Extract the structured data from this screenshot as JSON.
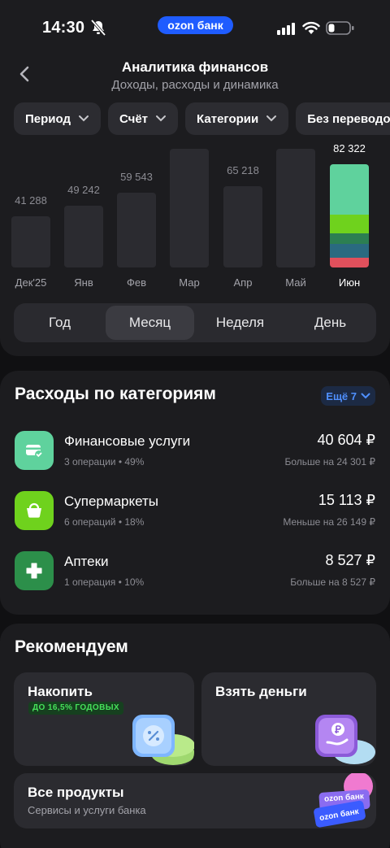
{
  "status_bar": {
    "time": "14:30",
    "bank_label": "ozon банк",
    "icons": [
      "bell-muted-icon",
      "signal-icon",
      "wifi-icon",
      "battery-icon"
    ]
  },
  "header": {
    "title": "Аналитика финансов",
    "subtitle": "Доходы, расходы и динамика"
  },
  "filters": [
    {
      "label": "Период"
    },
    {
      "label": "Счёт"
    },
    {
      "label": "Категории"
    },
    {
      "label": "Без переводов"
    }
  ],
  "chart_data": {
    "type": "bar",
    "categories": [
      "Дек'25",
      "Янв",
      "Фев",
      "Мар",
      "Апр",
      "Май",
      "Июн"
    ],
    "values": [
      41288,
      49242,
      59543,
      null,
      65218,
      null,
      82322
    ],
    "value_labels": [
      "41 288",
      "49 242",
      "59 543",
      "",
      "65 218",
      "",
      "82 322"
    ],
    "active_index": 6,
    "active_segments": [
      {
        "color": "#5fd29d",
        "share": 0.49
      },
      {
        "color": "#6fd21d",
        "share": 0.18
      },
      {
        "color": "#2c7f52",
        "share": 0.1
      },
      {
        "color": "#2a6a80",
        "share": 0.13
      },
      {
        "color": "#e0505c",
        "share": 0.1
      }
    ]
  },
  "period_tabs": [
    {
      "label": "Год",
      "selected": false
    },
    {
      "label": "Месяц",
      "selected": true
    },
    {
      "label": "Неделя",
      "selected": false
    },
    {
      "label": "День",
      "selected": false
    }
  ],
  "categories_section": {
    "title": "Расходы по категориям",
    "more_label": "Ещё 7",
    "items": [
      {
        "name": "Финансовые услуги",
        "meta": "3 операции • 49%",
        "amount": "40 604 ₽",
        "diff": "Больше на 24 301 ₽",
        "color": "#5fd29d",
        "icon": "card-check-icon"
      },
      {
        "name": "Супермаркеты",
        "meta": "6 операций • 18%",
        "amount": "15 113 ₽",
        "diff": "Меньше на 26 149 ₽",
        "color": "#6fd21d",
        "icon": "shopping-basket-icon"
      },
      {
        "name": "Аптеки",
        "meta": "1 операция • 10%",
        "amount": "8 527 ₽",
        "diff": "Больше на 8 527 ₽",
        "color": "#2c8f4a",
        "icon": "medical-cross-icon"
      }
    ]
  },
  "recommend_section": {
    "title": "Рекомендуем",
    "tiles": [
      {
        "title": "Накопить",
        "badge": "ДО 16,5% ГОДОВЫХ"
      },
      {
        "title": "Взять деньги"
      },
      {
        "title": "Все продукты",
        "subtitle": "Сервисы и услуги банка",
        "card_label_1": "ozon банк",
        "card_label_2": "ozon банк"
      }
    ]
  }
}
